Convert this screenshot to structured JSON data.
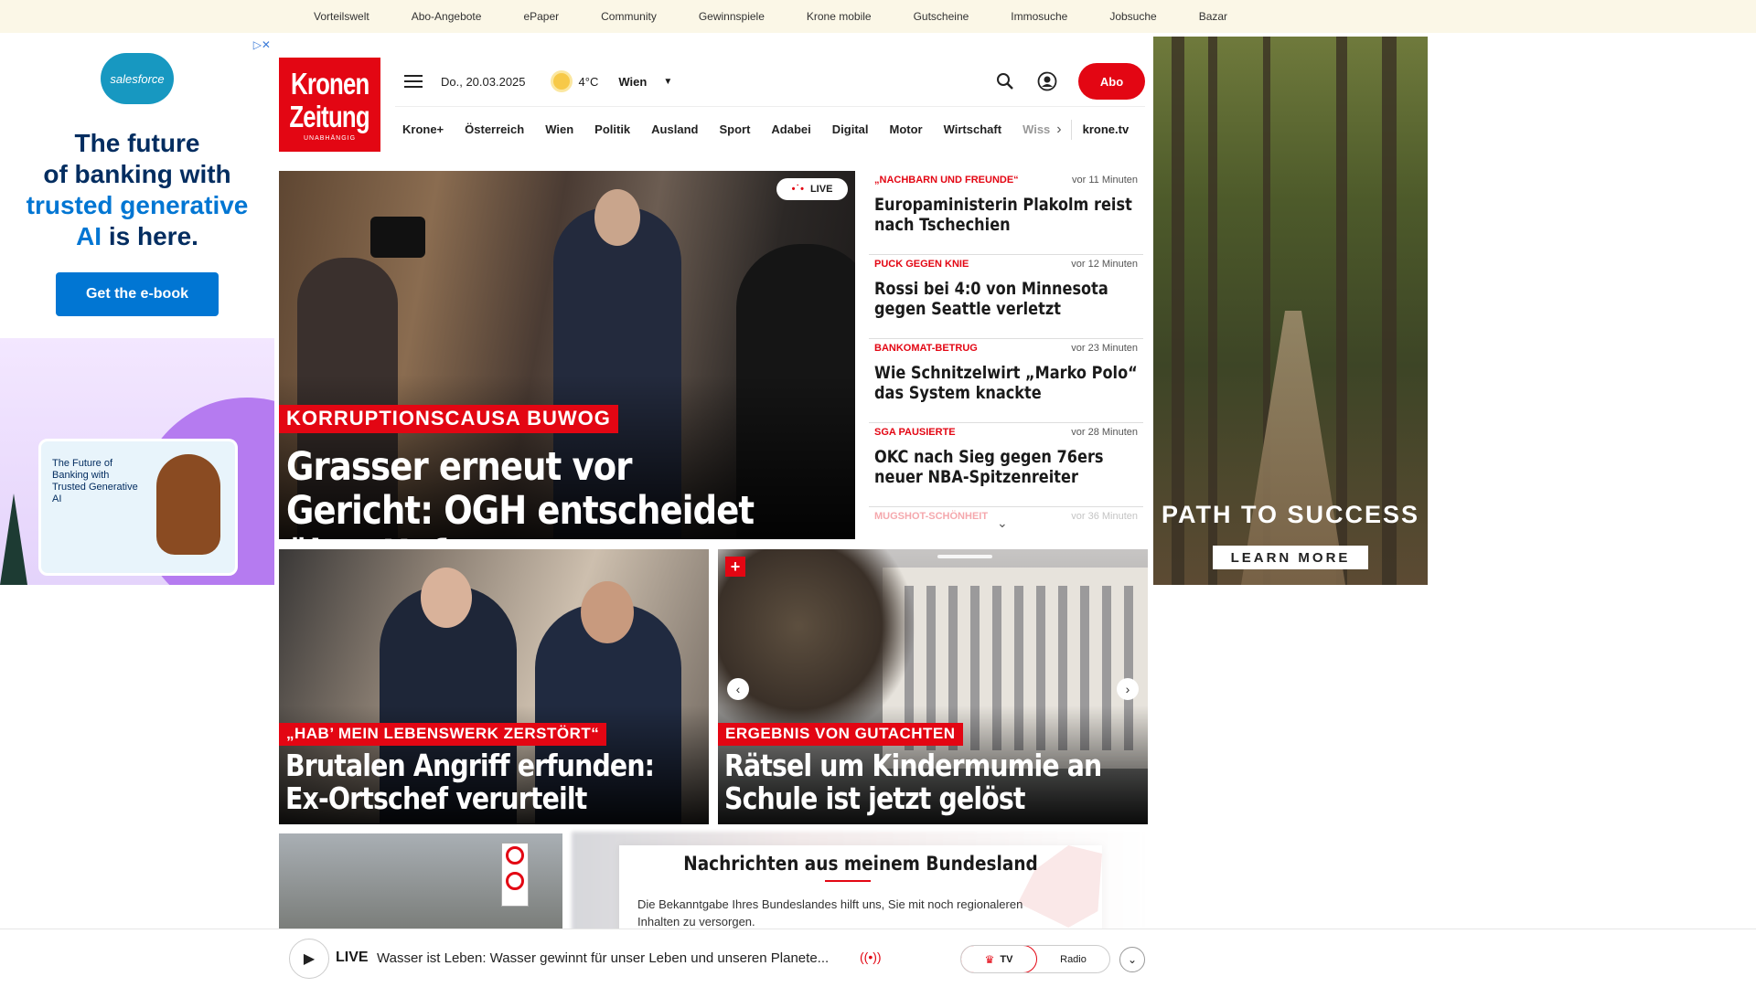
{
  "service_links": [
    "Vorteilswelt",
    "Abo-Angebote",
    "ePaper",
    "Community",
    "Gewinnspiele",
    "Krone mobile",
    "Gutscheine",
    "Immosuche",
    "Jobsuche",
    "Bazar"
  ],
  "ad_left": {
    "brand": "salesforce",
    "headline_1": "The future",
    "headline_2": "of banking with",
    "headline_3": "trusted generative",
    "headline_4": "AI",
    "headline_5": "is here.",
    "cta": "Get the e-book",
    "card_text": "The Future of Banking with Trusted Generative AI"
  },
  "ad_right": {
    "headline": "PATH TO SUCCESS",
    "cta": "LEARN MORE"
  },
  "logo": {
    "line1": "Kronen",
    "line2": "Zeitung",
    "tagline": "UNABHÄNGIG"
  },
  "header": {
    "date": "Do., 20.03.2025",
    "temp": "4°C",
    "city": "Wien",
    "abo": "Abo"
  },
  "nav": {
    "items": [
      "Krone+",
      "Österreich",
      "Wien",
      "Politik",
      "Ausland",
      "Sport",
      "Adabei",
      "Digital",
      "Motor",
      "Wirtschaft"
    ],
    "faded": "Wiss",
    "extra": "krone.tv"
  },
  "hero": {
    "live": "LIVE",
    "kicker": "KORRUPTIONSCAUSA BUWOG",
    "title": "Grasser erneut vor Gericht: OGH entscheidet über Haft"
  },
  "ticker": [
    {
      "category": "„NACHBARN UND FREUNDE“",
      "time": "vor 11 Minuten",
      "title": "Europaministerin Plakolm reist nach Tschechien"
    },
    {
      "category": "PUCK GEGEN KNIE",
      "time": "vor 12 Minuten",
      "title": "Rossi bei 4:0 von Minnesota gegen Seattle verletzt"
    },
    {
      "category": "BANKOMAT-BETRUG",
      "time": "vor 23 Minuten",
      "title": "Wie Schnitzelwirt „Marko Polo“ das System knackte"
    },
    {
      "category": "SGA PAUSIERTE",
      "time": "vor 28 Minuten",
      "title": "OKC nach Sieg gegen 76ers neuer NBA-Spitzenreiter"
    },
    {
      "category": "MUGSHOT-SCHÖNHEIT",
      "time": "vor 36 Minuten",
      "title": ""
    }
  ],
  "card1": {
    "kicker": "„HAB’ MEIN LEBENSWERK ZERSTÖRT“",
    "title": "Brutalen Angriff erfunden: Ex-Ortschef verurteilt"
  },
  "card2": {
    "kicker": "ERGEBNIS VON GUTACHTEN",
    "title": "Rätsel um Kindermumie an Schule ist jetzt gelöst"
  },
  "bundesland": {
    "title": "Nachrichten aus meinem Bundesland",
    "body": "Die Bekanntgabe Ihres Bundeslandes hilft uns, Sie mit noch regionaleren Inhalten zu versorgen."
  },
  "player": {
    "live": "LIVE",
    "text": "Wasser ist Leben: Wasser gewinnt für unser Leben und unseren Planete...",
    "tv": "TV",
    "radio": "Radio"
  },
  "colors": {
    "accent": "#e30613",
    "service_bar": "#fbf7e7",
    "salesforce_blue": "#0176d3"
  }
}
